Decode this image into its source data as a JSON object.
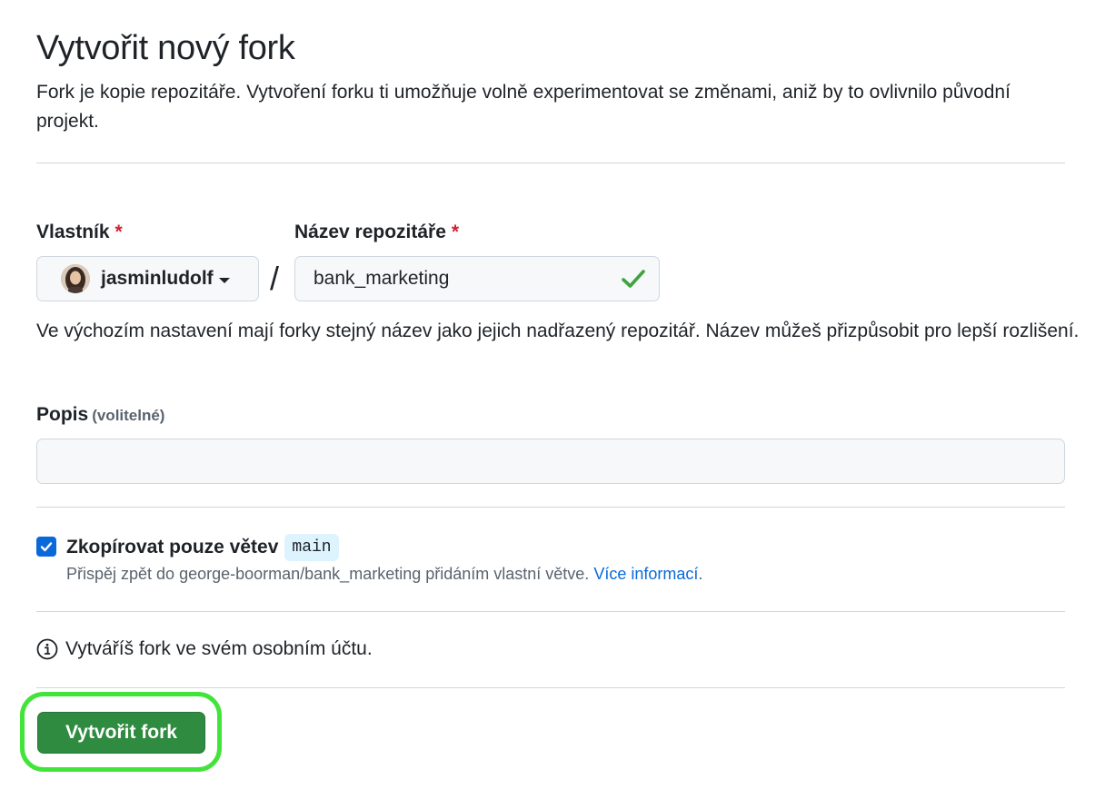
{
  "header": {
    "title": "Vytvořit nový fork",
    "subtitle": "Fork je kopie repozitáře. Vytvoření forku ti umožňuje volně experimentovat se změnami, aniž by to ovlivnilo původní projekt."
  },
  "owner": {
    "label": "Vlastník",
    "required_mark": "*",
    "selected": "jasminludolf"
  },
  "separator": "/",
  "repo_name": {
    "label": "Název repozitáře",
    "required_mark": "*",
    "value": "bank_marketing",
    "hint": "Ve výchozím nastavení mají forky stejný název jako jejich nadřazený repozitář. Název můžeš přizpůsobit pro lepší rozlišení."
  },
  "description": {
    "label": "Popis",
    "optional": "(volitelné)",
    "value": ""
  },
  "copy_branch": {
    "checked": true,
    "label": "Zkopírovat pouze větev",
    "branch": "main",
    "note": "Přispěj zpět do george-boorman/bank_marketing přidáním vlastní větve.",
    "link": "Více informací",
    "link_suffix": "."
  },
  "info": {
    "text": "Vytváříš fork ve svém osobním účtu."
  },
  "submit": {
    "label": "Vytvořit fork"
  },
  "colors": {
    "accent_green": "#2f8b3f",
    "highlight": "#43e43a",
    "link_blue": "#0969da",
    "required_red": "#cf222e"
  }
}
